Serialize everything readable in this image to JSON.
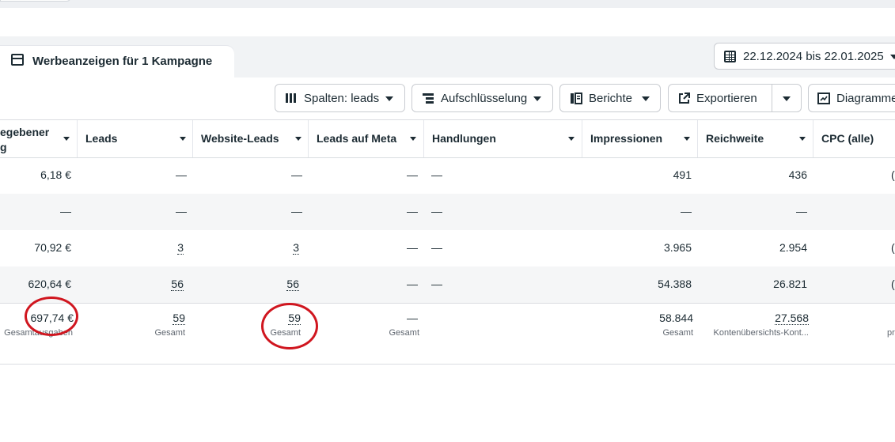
{
  "tab": {
    "title": "Werbeanzeigen für 1 Kampagne",
    "icon": "window-icon"
  },
  "date_range": {
    "label": "22.12.2024 bis 22.01.2025",
    "icon": "calendar-icon"
  },
  "toolbar": {
    "columns_label": "Spalten: leads",
    "breakdown_label": "Aufschlüsselung",
    "reports_label": "Berichte",
    "export_label": "Exportieren",
    "charts_label": "Diagramme"
  },
  "columns": [
    {
      "line1": "egebener",
      "line2": "g"
    },
    "Leads",
    "Website-Leads",
    "Leads auf Meta",
    "Handlungen",
    "Impressionen",
    "Reichweite",
    "CPC (alle)"
  ],
  "rows": [
    {
      "spend": "6,18 €",
      "leads": "—",
      "website_leads": "—",
      "meta_leads": "—",
      "actions": "—",
      "impressions": "491",
      "reach": "436",
      "cpc": "("
    },
    {
      "spend": "—",
      "leads": "—",
      "website_leads": "—",
      "meta_leads": "—",
      "actions": "—",
      "impressions": "—",
      "reach": "—",
      "cpc": ""
    },
    {
      "spend": "70,92 €",
      "leads": "3",
      "website_leads": "3",
      "meta_leads": "—",
      "actions": "—",
      "impressions": "3.965",
      "reach": "2.954",
      "cpc": "("
    },
    {
      "spend": "620,64 €",
      "leads": "56",
      "website_leads": "56",
      "meta_leads": "—",
      "actions": "—",
      "impressions": "54.388",
      "reach": "26.821",
      "cpc": "("
    }
  ],
  "totals": {
    "spend": {
      "value": "697,74 €",
      "sub": "Gesamtausgaben"
    },
    "leads": {
      "value": "59",
      "sub": "Gesamt"
    },
    "website_leads": {
      "value": "59",
      "sub": "Gesamt"
    },
    "meta_leads": {
      "value": "—",
      "sub": "Gesamt"
    },
    "impressions": {
      "value": "58.844",
      "sub": "Gesamt"
    },
    "reach": {
      "value": "27.568",
      "sub": "Kontenübersichts-Kont..."
    },
    "cpc": {
      "sub": "pr"
    }
  },
  "colors": {
    "annotation": "#d0161f",
    "text": "#1c2b33",
    "row_alt": "#f5f6f7"
  }
}
